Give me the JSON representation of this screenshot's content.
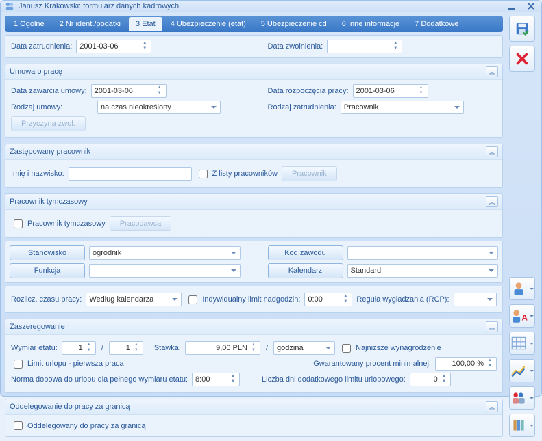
{
  "window": {
    "title": "Janusz Krakowski: formularz danych kadrowych"
  },
  "tabs": [
    "1 Ogólne",
    "2 Nr ident./podatki",
    "3 Etat",
    "4 Ubezpieczenie (etat)",
    "5 Ubezpieczenie cd",
    "6 Inne informacje",
    "7 Dodatkowe"
  ],
  "active_tab": 2,
  "top": {
    "hire_label": "Data zatrudnienia:",
    "hire_date": "2001-03-06",
    "fire_label": "Data zwolnienia:",
    "fire_date": ""
  },
  "umowa": {
    "legend": "Umowa o pracę",
    "zawarcie_label": "Data zawarcia umowy:",
    "zawarcie": "2001-03-06",
    "rozpoczecie_label": "Data rozpoczęcia pracy:",
    "rozpoczecie": "2001-03-06",
    "rodzaj_umowy_label": "Rodzaj umowy:",
    "rodzaj_umowy": "na czas nieokreślony",
    "rodzaj_zatr_label": "Rodzaj zatrudnienia:",
    "rodzaj_zatr": "Pracownik",
    "przyczyna_btn": "Przyczyna zwol."
  },
  "zastep": {
    "legend": "Zastępowany pracownik",
    "imie_label": "Imię i nazwisko:",
    "imie": "",
    "zlisty_label": "Z listy pracowników",
    "pracownik_btn": "Pracownik"
  },
  "tymcz": {
    "legend": "Pracownik tymczasowy",
    "chk_label": "Pracownik tymczasowy",
    "pracodawca_btn": "Pracodawca"
  },
  "stan": {
    "stanowisko_btn": "Stanowisko",
    "stanowisko": "ogrodnik",
    "funkcja_btn": "Funkcja",
    "funkcja": "",
    "kod_btn": "Kod zawodu",
    "kod": "",
    "kalendarz_btn": "Kalendarz",
    "kalendarz": "Standard"
  },
  "rozlicz": {
    "label": "Rozlicz. czasu pracy:",
    "value": "Według kalendarza",
    "ind_limit_label": "Indywidualny limit nadgodzin:",
    "ind_limit": "0:00",
    "regula_label": "Reguła wygładzania (RCP):",
    "regula": ""
  },
  "zaszer": {
    "legend": "Zaszeregowanie",
    "wymiar_label": "Wymiar etatu:",
    "wymiar_a": "1",
    "wymiar_b": "1",
    "stawka_label": "Stawka:",
    "stawka": "9,00 PLN",
    "stawka_per": "godzina",
    "najnizsze_label": "Najniższe wynagrodzenie",
    "limit_urlop_label": "Limit urlopu - pierwsza praca",
    "gwarant_label": "Gwarantowany procent minimalnej:",
    "gwarant": "100,00 %",
    "norma_label": "Norma dobowa do urlopu dla pełnego wymiaru etatu:",
    "norma": "8:00",
    "liczba_dni_label": "Liczba dni dodatkowego limitu urlopowego:",
    "liczba_dni": "0"
  },
  "oddel": {
    "legend": "Oddelegowanie do pracy za granicą",
    "chk_label": "Oddelegowany do pracy za granicą"
  }
}
